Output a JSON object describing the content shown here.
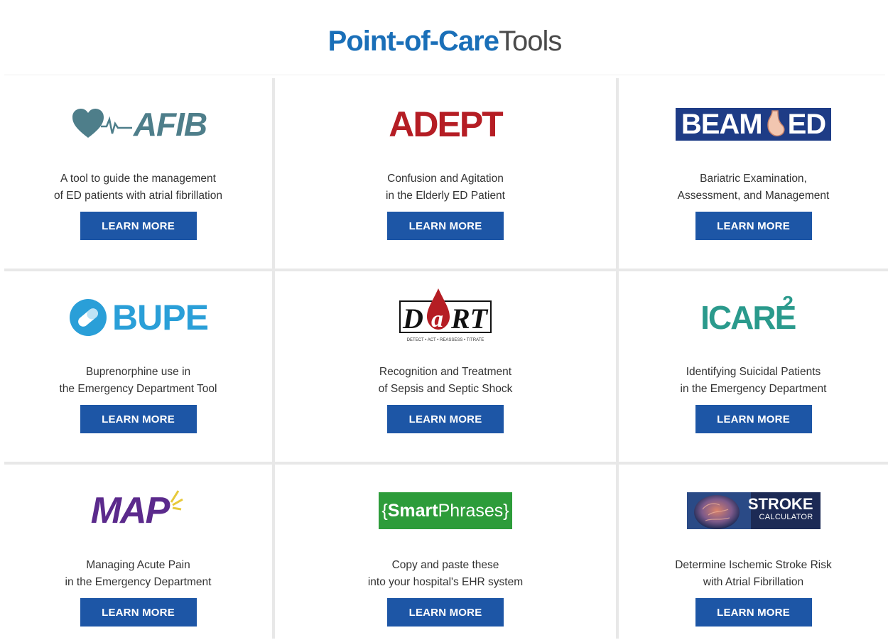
{
  "header": {
    "title_strong": "Point-of-Care",
    "title_light": "Tools"
  },
  "colors": {
    "brand_blue": "#1a6fb8",
    "button_bg": "#1d56a6",
    "afib": "#4e7e8a",
    "adept": "#b51d24",
    "beamed": "#1e3c86",
    "bupe": "#2a9fd8",
    "dart": "#b51d24",
    "icare": "#2a9a8c",
    "map": "#5b2a8c",
    "smartphrases": "#2d9c3a",
    "stroke": "#1c2a55"
  },
  "tools": [
    {
      "logo_text": "AFIB",
      "logo_icon": "heart-ecg-icon",
      "desc_line1": "A tool to guide the management",
      "desc_line2": "of ED patients with atrial fibrillation",
      "button_label": "LEARN MORE"
    },
    {
      "logo_text": "ADEPT",
      "desc_line1": "Confusion and Agitation",
      "desc_line2": "in the Elderly ED Patient",
      "button_label": "LEARN MORE"
    },
    {
      "logo_text_a": "BEAM",
      "logo_text_b": "ED",
      "logo_icon": "stomach-icon",
      "desc_line1": "Bariatric Examination,",
      "desc_line2": "Assessment, and Management",
      "button_label": "LEARN MORE"
    },
    {
      "logo_text": "BUPE",
      "logo_icon": "pill-icon",
      "desc_line1": "Buprenorphine use in",
      "desc_line2": "the Emergency Department Tool",
      "button_label": "LEARN MORE"
    },
    {
      "logo_text_a": "D",
      "logo_text_b": "a",
      "logo_text_c": "RT",
      "logo_tagline": "DETECT • ACT • REASSESS • TITRATE",
      "logo_icon": "blood-drop-icon",
      "desc_line1": "Recognition and Treatment",
      "desc_line2": "of Sepsis and Septic Shock",
      "button_label": "LEARN MORE"
    },
    {
      "logo_text": "ICARE",
      "logo_sup": "2",
      "desc_line1": "Identifying Suicidal Patients",
      "desc_line2": "in the Emergency Department",
      "button_label": "LEARN MORE"
    },
    {
      "logo_text": "MAP",
      "logo_icon": "spark-icon",
      "desc_line1": "Managing Acute Pain",
      "desc_line2": "in the Emergency Department",
      "button_label": "LEARN MORE"
    },
    {
      "logo_text_open": "{",
      "logo_text_a": "Smart",
      "logo_text_b": "Phrases",
      "logo_text_close": "}",
      "desc_line1": "Copy and paste these",
      "desc_line2": "into your hospital's EHR system",
      "button_label": "LEARN MORE"
    },
    {
      "logo_text_a": "STROKE",
      "logo_text_b": "CALCULATOR",
      "logo_icon": "brain-icon",
      "desc_line1": "Determine Ischemic Stroke Risk",
      "desc_line2": "with Atrial Fibrillation",
      "button_label": "LEARN MORE"
    }
  ]
}
